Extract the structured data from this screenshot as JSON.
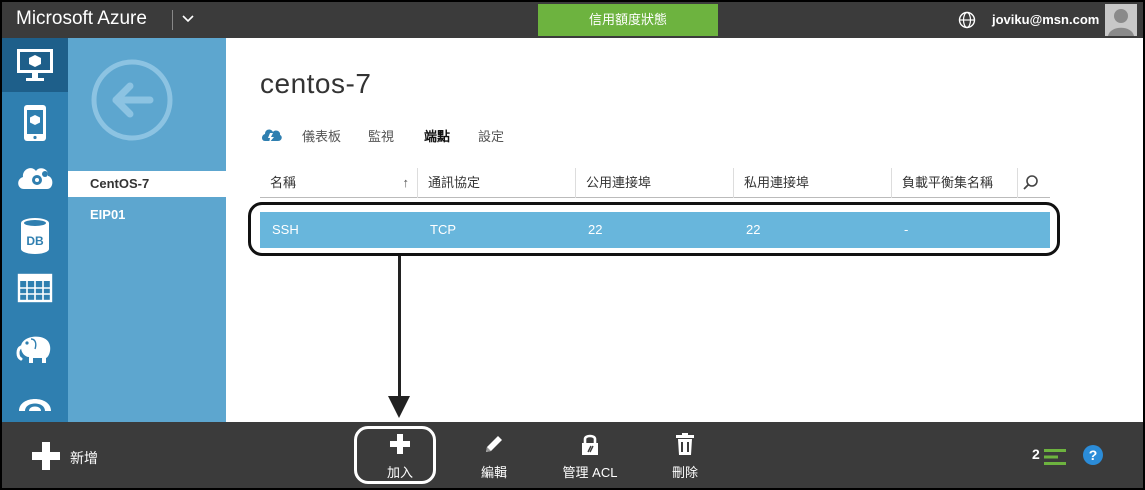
{
  "app": {
    "title": "Microsoft Azure",
    "credit_label": "信用額度狀態",
    "user_email": "joviku@msn.com"
  },
  "rail": {
    "items": [
      {
        "icon": "virtual-machine-icon",
        "active": true
      },
      {
        "icon": "mobile-service-icon"
      },
      {
        "icon": "cloud-service-icon"
      },
      {
        "icon": "sql-database-icon",
        "label": "DB"
      },
      {
        "icon": "storage-table-icon"
      },
      {
        "icon": "hdinsight-elephant-icon"
      },
      {
        "icon": "media-service-icon"
      }
    ]
  },
  "subnav": {
    "items": [
      {
        "label": "CentOS-7",
        "selected": true
      },
      {
        "label": "EIP01"
      }
    ]
  },
  "main": {
    "title": "centos-7",
    "tabs": [
      {
        "label": "儀表板"
      },
      {
        "label": "監視"
      },
      {
        "label": "端點",
        "active": true
      },
      {
        "label": "設定"
      }
    ]
  },
  "table": {
    "columns": [
      "名稱",
      "通訊協定",
      "公用連接埠",
      "私用連接埠",
      "負載平衡集名稱"
    ],
    "sort_indicator": "↑",
    "rows": [
      {
        "name": "SSH",
        "protocol": "TCP",
        "public_port": "22",
        "private_port": "22",
        "lb_set": "-"
      }
    ]
  },
  "bottombar": {
    "new_label": "新增",
    "commands": [
      {
        "label": "加入",
        "icon": "plus-icon"
      },
      {
        "label": "編輯",
        "icon": "pencil-icon"
      },
      {
        "label": "管理 ACL",
        "icon": "lock-icon"
      },
      {
        "label": "刪除",
        "icon": "trash-icon"
      }
    ],
    "count": "2"
  },
  "colors": {
    "topbar": "#3b3b3b",
    "credit": "#6db33f",
    "rail": "#2f7fb0",
    "subnav": "#5da6cf",
    "row_selected": "#68b6dc",
    "help": "#2b8cd8"
  }
}
